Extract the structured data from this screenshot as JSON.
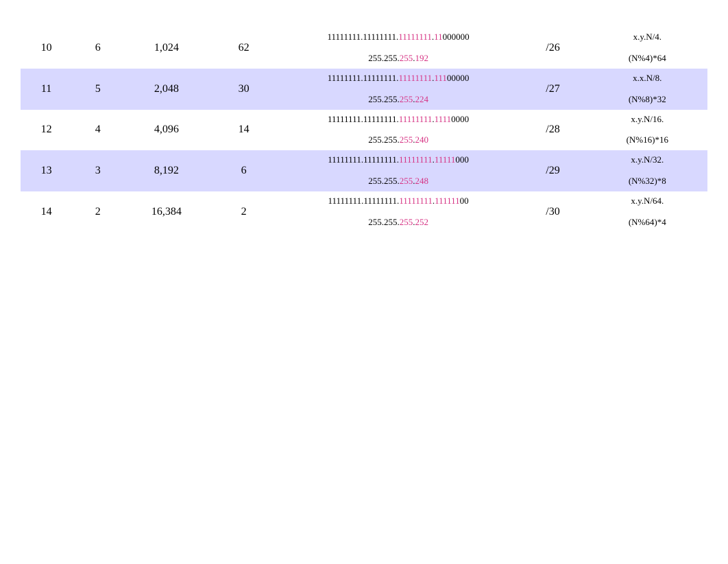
{
  "rows": [
    {
      "bits": "10",
      "hostbits": "6",
      "subnets": "1,024",
      "hosts": "62",
      "bin_prefix": "11111111.11111111.",
      "bin_mag1": "11111111",
      "bin_dot": ".",
      "bin_mag2": "11",
      "bin_suffix": "000000",
      "dec_prefix": "255.255.",
      "dec_mag1": "255",
      "dec_dot": ".",
      "dec_mag2": "192",
      "cidr": "/26",
      "formula_top": "x.y.N/4.",
      "formula_bottom": "(N%4)*64"
    },
    {
      "bits": "11",
      "hostbits": "5",
      "subnets": "2,048",
      "hosts": "30",
      "bin_prefix": "11111111.11111111.",
      "bin_mag1": "11111111",
      "bin_dot": ".",
      "bin_mag2": "111",
      "bin_suffix": "00000",
      "dec_prefix": "255.255.",
      "dec_mag1": "255",
      "dec_dot": ".",
      "dec_mag2": "224",
      "cidr": "/27",
      "formula_top": "x.x.N/8.",
      "formula_bottom": "(N%8)*32"
    },
    {
      "bits": "12",
      "hostbits": "4",
      "subnets": "4,096",
      "hosts": "14",
      "bin_prefix": "11111111.11111111.",
      "bin_mag1": "11111111",
      "bin_dot": ".",
      "bin_mag2": "1111",
      "bin_suffix": "0000",
      "dec_prefix": "255.255.",
      "dec_mag1": "255",
      "dec_dot": ".",
      "dec_mag2": "240",
      "cidr": "/28",
      "formula_top": "x.y.N/16.",
      "formula_bottom": "(N%16)*16"
    },
    {
      "bits": "13",
      "hostbits": "3",
      "subnets": "8,192",
      "hosts": "6",
      "bin_prefix": "11111111.11111111.",
      "bin_mag1": "11111111",
      "bin_dot": ".",
      "bin_mag2": "11111",
      "bin_suffix": "000",
      "dec_prefix": "255.255.",
      "dec_mag1": "255",
      "dec_dot": ".",
      "dec_mag2": "248",
      "cidr": "/29",
      "formula_top": "x.y.N/32.",
      "formula_bottom": "(N%32)*8"
    },
    {
      "bits": "14",
      "hostbits": "2",
      "subnets": "16,384",
      "hosts": "2",
      "bin_prefix": "11111111.11111111.",
      "bin_mag1": "11111111",
      "bin_dot": ".",
      "bin_mag2": "111111",
      "bin_suffix": "00",
      "dec_prefix": "255.255.",
      "dec_mag1": "255",
      "dec_dot": ".",
      "dec_mag2": "252",
      "cidr": "/30",
      "formula_top": "x.y.N/64.",
      "formula_bottom": "(N%64)*4"
    }
  ]
}
